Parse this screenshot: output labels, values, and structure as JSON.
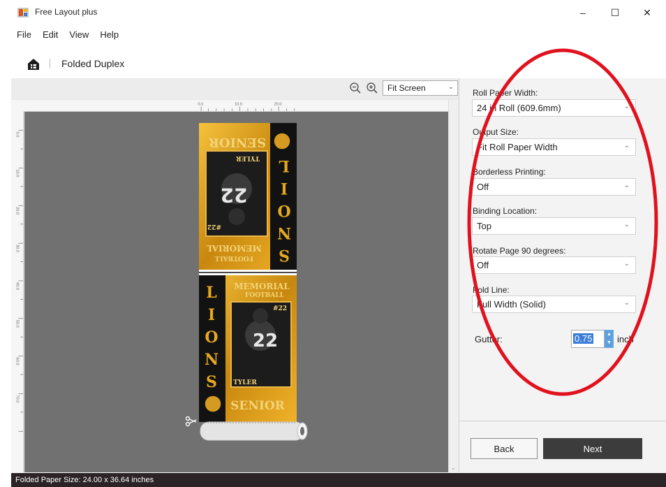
{
  "window": {
    "title": "Free Layout plus",
    "controls": {
      "minimize": "–",
      "maximize": "☐",
      "close": "✕"
    }
  },
  "menu": [
    "File",
    "Edit",
    "View",
    "Help"
  ],
  "subheader": {
    "title": "Folded Duplex",
    "home_icon": "home-icon"
  },
  "zoom": {
    "value": "Fit Screen"
  },
  "ruler": {
    "horizontal": [
      "0.0",
      "10.0",
      "20.0"
    ],
    "vertical": [
      "0.0",
      "10.0",
      "20.0",
      "30.0",
      "40.0",
      "50.0",
      "60.0",
      "70.0"
    ]
  },
  "card": {
    "top_name": "SENIOR",
    "player": "TYLER",
    "team_vertical": [
      "L",
      "I",
      "O",
      "N",
      "S"
    ],
    "number": "#22",
    "memorial": "MEMORIAL",
    "football": "FOOTBALL",
    "jersey": "22",
    "bottom_name": "SENIOR"
  },
  "settings": {
    "roll_paper_width": {
      "label": "Roll Paper Width:",
      "value": "24 in Roll (609.6mm)"
    },
    "output_size": {
      "label": "Output Size:",
      "value": "Fit Roll Paper Width"
    },
    "borderless": {
      "label": "Borderless Printing:",
      "value": "Off"
    },
    "binding": {
      "label": "Binding Location:",
      "value": "Top"
    },
    "rotate": {
      "label": "Rotate Page 90 degrees:",
      "value": "Off"
    },
    "fold_line": {
      "label": "Fold Line:",
      "value": "Full Width (Solid)"
    },
    "gutter": {
      "label": "Gutter:",
      "value": "0.75",
      "unit": "inch"
    }
  },
  "buttons": {
    "back": "Back",
    "next": "Next"
  },
  "status": "Folded Paper Size: 24.00 x 36.64 inches",
  "colors": {
    "annotation": "#e0121e",
    "status_bar": "#2b2325",
    "next_button": "#3c3c3c",
    "gold": "#e2a31c"
  }
}
